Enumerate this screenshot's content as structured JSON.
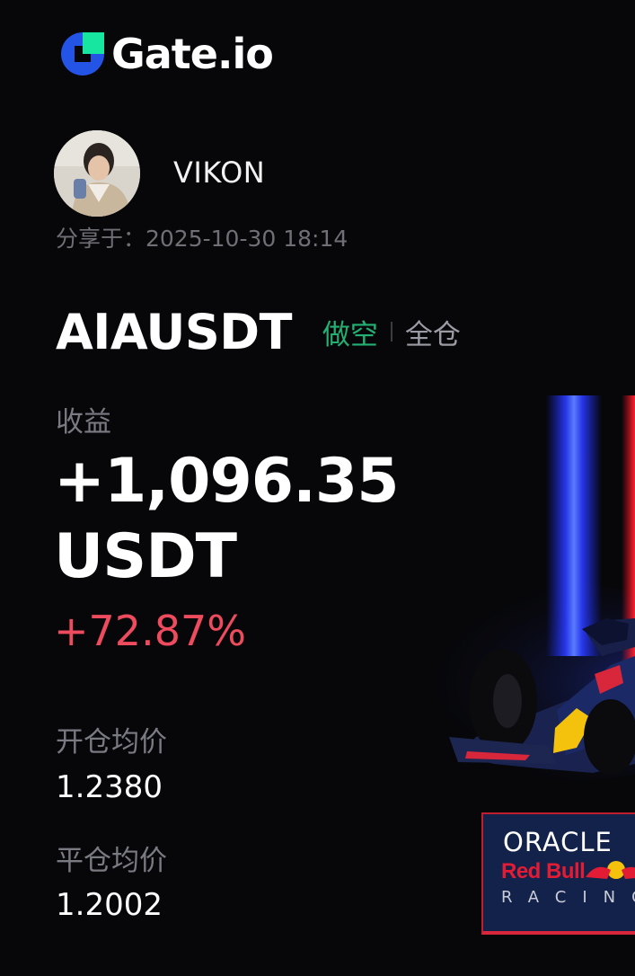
{
  "brand": {
    "name": "Gate.io",
    "colors": {
      "mark_blue": "#2354e6",
      "mark_green": "#17e6a1"
    }
  },
  "profile": {
    "username": "VIKON",
    "avatar_icon": "user-photo"
  },
  "share": {
    "text": "分享于：2025-10-30 18:14"
  },
  "position": {
    "pair": "AIAUSDT",
    "side": "做空",
    "margin_mode": "全仓"
  },
  "pnl": {
    "label": "收益",
    "value": "+1,096.35",
    "unit": "USDT",
    "percent": "+72.87%"
  },
  "prices": {
    "entry_label": "开仓均价",
    "entry_value": "1.2380",
    "close_label": "平仓均价",
    "close_value": "1.2002"
  },
  "sponsor": {
    "line1": "ORACLE",
    "line2": "Red Bull",
    "line3": "RACING"
  },
  "colors": {
    "short": "#23b073",
    "profit": "#ee4b5e",
    "muted": "#7a7a82",
    "background": "#07070a"
  }
}
